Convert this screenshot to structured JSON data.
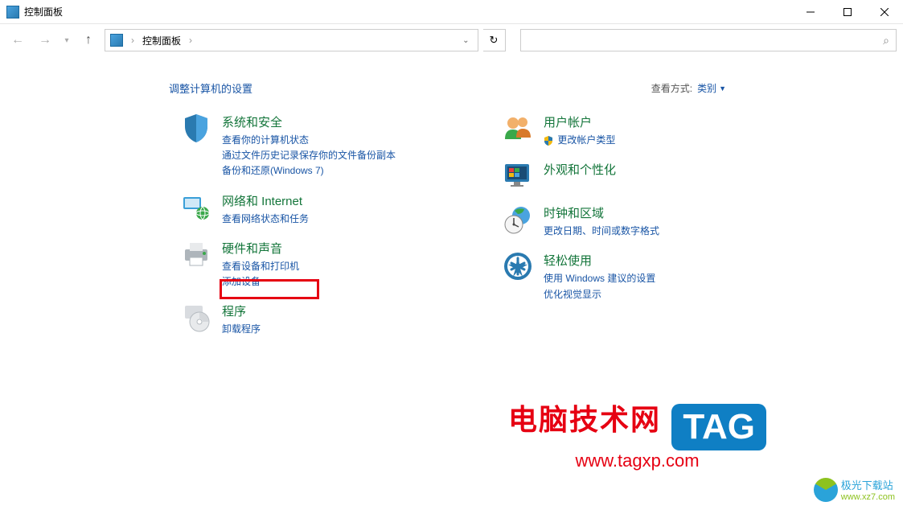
{
  "window": {
    "title": "控制面板"
  },
  "breadcrumb": {
    "root": "控制面板"
  },
  "search": {
    "placeholder": ""
  },
  "heading": "调整计算机的设置",
  "view_by": {
    "label": "查看方式:",
    "value": "类别"
  },
  "categories": {
    "system_security": {
      "title": "系统和安全",
      "links": [
        "查看你的计算机状态",
        "通过文件历史记录保存你的文件备份副本",
        "备份和还原(Windows 7)"
      ]
    },
    "network": {
      "title": "网络和 Internet",
      "links": [
        "查看网络状态和任务"
      ]
    },
    "hardware": {
      "title": "硬件和声音",
      "links": [
        "查看设备和打印机",
        "添加设备"
      ]
    },
    "programs": {
      "title": "程序",
      "links": [
        "卸载程序"
      ]
    },
    "user_accounts": {
      "title": "用户帐户",
      "links": [
        "更改帐户类型"
      ]
    },
    "appearance": {
      "title": "外观和个性化",
      "links": []
    },
    "clock_region": {
      "title": "时钟和区域",
      "links": [
        "更改日期、时间或数字格式"
      ]
    },
    "ease_of_access": {
      "title": "轻松使用",
      "links": [
        "使用 Windows 建议的设置",
        "优化视觉显示"
      ]
    }
  },
  "watermarks": {
    "wm1_line1": "电脑技术网",
    "wm1_line2": "www.tagxp.com",
    "wm1_tag": "TAG",
    "wm2_text": "极光下载站",
    "wm2_url": "www.xz7.com"
  }
}
